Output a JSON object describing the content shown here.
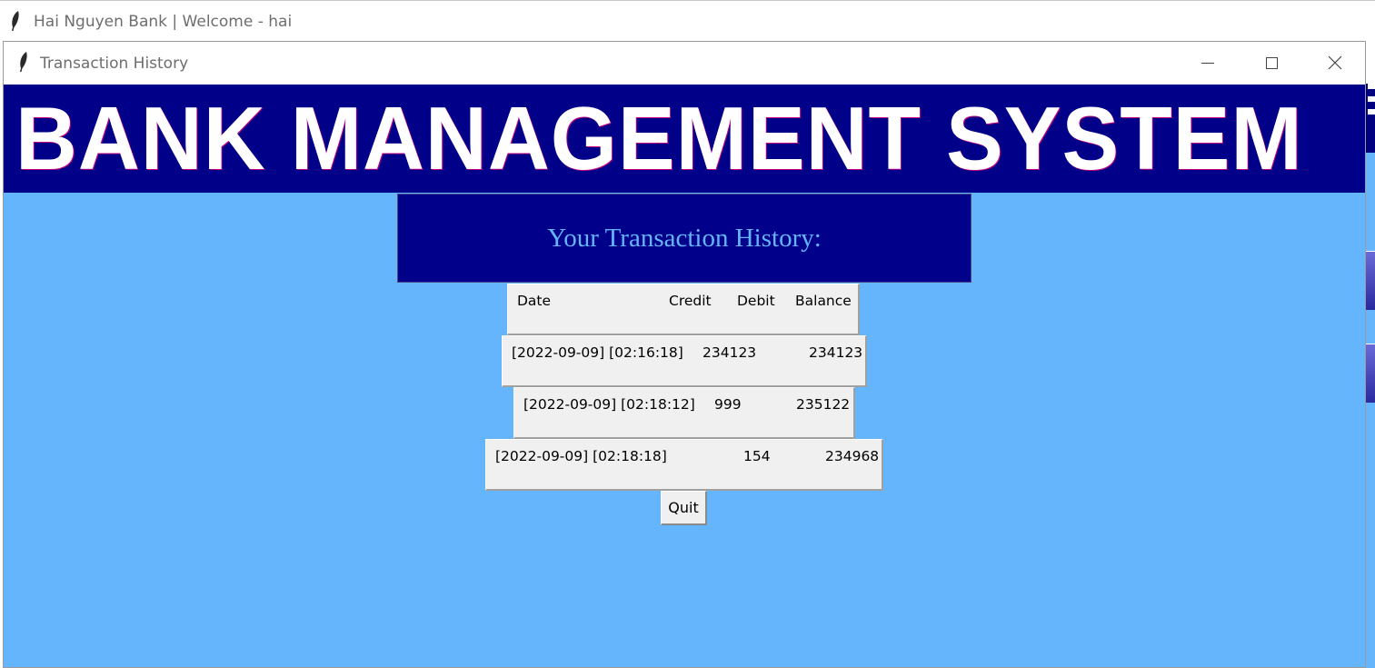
{
  "background_window": {
    "title": "Hai Nguyen Bank | Welcome - hai"
  },
  "window": {
    "title": "Transaction History",
    "controls": {
      "minimize_icon": "minimize-icon",
      "maximize_icon": "maximize-icon",
      "close_icon": "close-icon"
    }
  },
  "banner": {
    "text": "BANK MANAGEMENT SYSTEM"
  },
  "subtitle": {
    "text": "Your Transaction History:"
  },
  "table": {
    "headers": {
      "date": "Date",
      "credit": "Credit",
      "debit": "Debit",
      "balance": "Balance"
    },
    "rows": [
      {
        "date": "[2022-09-09] [02:16:18]",
        "credit": "234123",
        "debit": "",
        "balance": "234123"
      },
      {
        "date": "[2022-09-09] [02:18:12]",
        "credit": "999",
        "debit": "",
        "balance": "235122"
      },
      {
        "date": "[2022-09-09] [02:18:18]",
        "credit": "",
        "debit": "154",
        "balance": "234968"
      }
    ]
  },
  "quit_button": {
    "label": "Quit"
  },
  "colors": {
    "background": "#64b5fb",
    "banner": "#000089",
    "subtitle_bg": "#00008b",
    "subtitle_text": "#64b5fb",
    "row_bg": "#f0f0f0"
  }
}
